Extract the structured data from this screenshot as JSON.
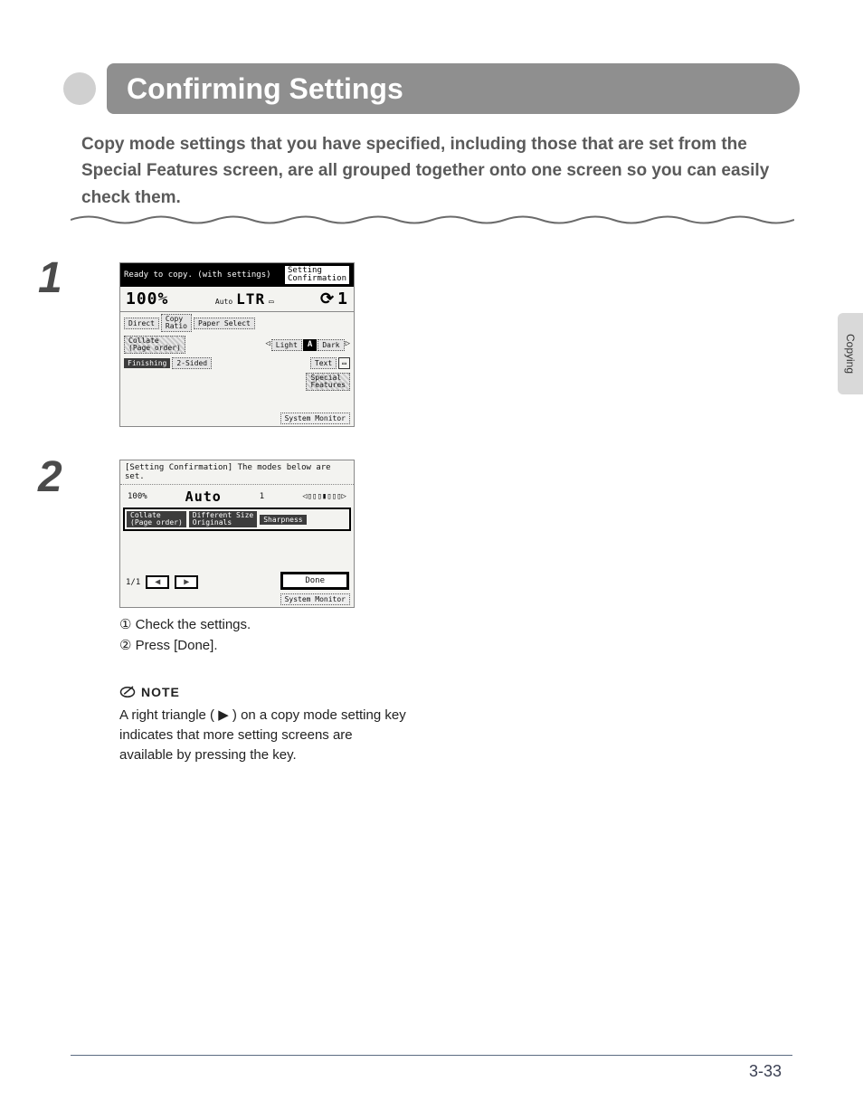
{
  "heading": "Confirming Settings",
  "intro": "Copy mode settings that you have specified, including those that are set from the Special Features screen, are all grouped together onto one screen so you can easily check them.",
  "side_tab": "Copying",
  "steps": {
    "one_num": "1",
    "two_num": "2",
    "two_lines": [
      "① Check the settings.",
      "② Press [Done]."
    ]
  },
  "note": {
    "label": "NOTE",
    "text": "A right triangle ( ▶ ) on a copy mode setting key indicates that more setting screens are available by pressing the key."
  },
  "lcd1": {
    "status": "Ready to copy. (with settings)",
    "setting_conf": "Setting\nConfirmation",
    "zoom": "100%",
    "paper_auto": "Auto",
    "paper_size": "LTR",
    "copies_icon": "1",
    "buttons": {
      "direct": "Direct",
      "copy_ratio": "Copy\nRatio",
      "paper_select": "Paper Select",
      "collate": "Collate\n(Page order)",
      "two_sided": "2-Sided",
      "finishing": "Finishing",
      "text_mode": "Text",
      "light": "Light",
      "a": "A",
      "dark": "Dark",
      "special": "Special\nFeatures"
    },
    "sys_monitor": "System Monitor"
  },
  "lcd2": {
    "title": "[Setting Confirmation] The modes below are set.",
    "zoom": "100%",
    "paper_auto": "Auto",
    "copies": "1",
    "density_icon": "◁▯▯▯▮▯▯▯▷",
    "modes": {
      "collate": "Collate\n(Page order)",
      "diff_size": "Different Size\nOriginals",
      "sharpness": "Sharpness"
    },
    "pager": "1/1",
    "done": "Done",
    "sys_monitor": "System Monitor"
  },
  "page_number": "3-33"
}
